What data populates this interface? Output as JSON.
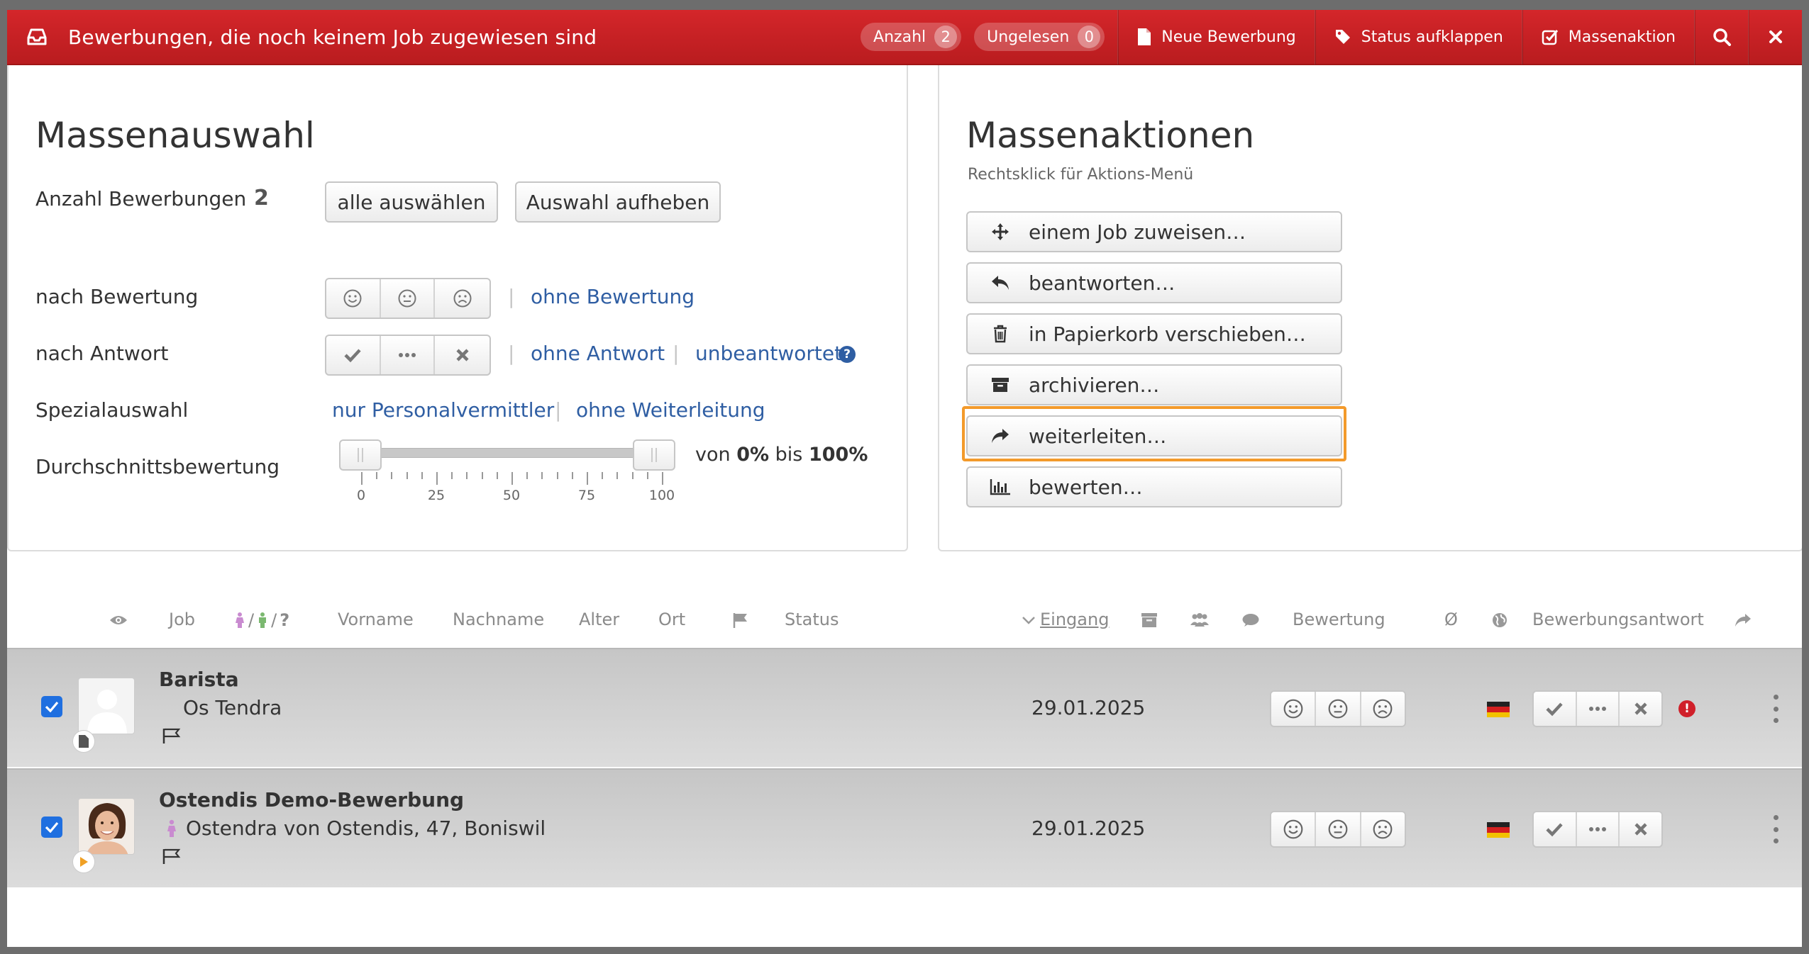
{
  "header": {
    "title": "Bewerbungen, die noch keinem Job zugewiesen sind",
    "badges": [
      {
        "label": "Anzahl",
        "count": "2"
      },
      {
        "label": "Ungelesen",
        "count": "0"
      }
    ],
    "buttons": {
      "new": "Neue Bewerbung",
      "status": "Status aufklappen",
      "mass": "Massenaktion"
    },
    "colors": {
      "bar": "#c8202a",
      "highlight": "#f39a2b",
      "link": "#2f5ea3"
    }
  },
  "selection": {
    "title": "Massenauswahl",
    "count_label": "Anzahl Bewerbungen",
    "count_value": "2",
    "select_all": "alle auswählen",
    "deselect": "Auswahl aufheben",
    "by_rating": "nach Bewertung",
    "no_rating": "ohne Bewertung",
    "by_answer": "nach Antwort",
    "no_answer": "ohne Antwort",
    "unanswered": "unbeantwortet",
    "special": "Spezialauswahl",
    "only_agency": "nur Personalvermittler",
    "no_forward": "ohne Weiterleitung",
    "avg_rating": "Durchschnittsbewertung",
    "range": {
      "von": "von",
      "min": "0%",
      "bis": "bis",
      "max": "100%"
    },
    "slider": {
      "min": 0,
      "max": 100,
      "low": 0,
      "high": 100,
      "labels": [
        "0",
        "25",
        "50",
        "75",
        "100"
      ]
    }
  },
  "actions": {
    "title": "Massenaktionen",
    "subtitle": "Rechtsklick für Aktions-Menü",
    "items": [
      {
        "label": "einem Job zuweisen…",
        "icon": "move-icon"
      },
      {
        "label": "beantworten…",
        "icon": "reply-icon"
      },
      {
        "label": "in Papierkorb verschieben…",
        "icon": "trash-icon"
      },
      {
        "label": "archivieren…",
        "icon": "archive-icon"
      },
      {
        "label": "weiterleiten…",
        "icon": "forward-icon"
      },
      {
        "label": "bewerten…",
        "icon": "chart-icon"
      }
    ]
  },
  "columns": {
    "job": "Job",
    "gender_sep1": "/",
    "gender_sep2": "/",
    "gender_q": "?",
    "firstname": "Vorname",
    "lastname": "Nachname",
    "age": "Alter",
    "place": "Ort",
    "status": "Status",
    "received": "Eingang",
    "rating": "Bewertung",
    "avg": "Ø",
    "answer": "Bewerbungsantwort"
  },
  "rows": [
    {
      "job": "Barista",
      "candidate": "Os Tendra",
      "date": "29.01.2025",
      "checked": true,
      "warning": "!"
    },
    {
      "job": "Ostendis Demo-Bewerbung",
      "candidate": "Ostendra von Ostendis, 47, Boniswil",
      "date": "29.01.2025",
      "checked": true
    }
  ]
}
